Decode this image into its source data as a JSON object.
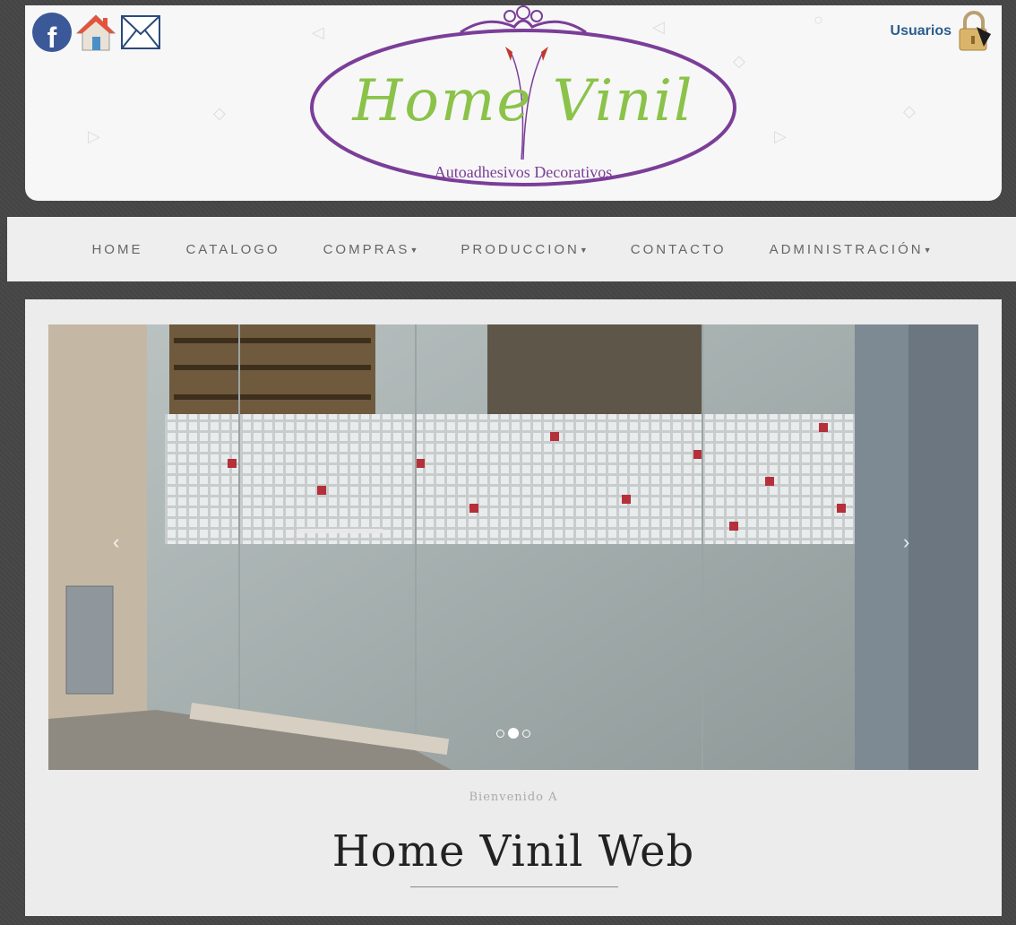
{
  "header": {
    "social_icons": [
      "facebook-icon",
      "home-icon",
      "mail-icon"
    ],
    "users_label": "Usuarios",
    "users_icon": "padlock-icon",
    "logo": {
      "title": "Home Vinil",
      "subtitle": "Autoadhesivos Decorativos",
      "colors": {
        "title": "#8bc34a",
        "oval": "#7b3e98"
      }
    }
  },
  "nav": {
    "items": [
      {
        "label": "HOME",
        "dropdown": false
      },
      {
        "label": "CATALOGO",
        "dropdown": false
      },
      {
        "label": "COMPRAS",
        "dropdown": true
      },
      {
        "label": "PRODUCCION",
        "dropdown": true
      },
      {
        "label": "CONTACTO",
        "dropdown": false
      },
      {
        "label": "ADMINISTRACIÓN",
        "dropdown": true
      }
    ]
  },
  "carousel": {
    "prev_glyph": "‹",
    "next_glyph": "›",
    "slide_count": 3,
    "active_slide": 2
  },
  "main": {
    "welcome": "Bienvenido A",
    "title": "Home Vinil Web"
  }
}
